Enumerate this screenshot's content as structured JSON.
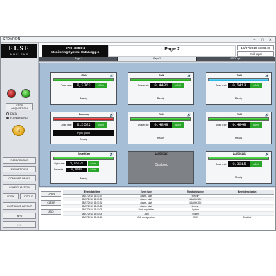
{
  "window": {
    "title": "STDMRON"
  },
  "logo": {
    "line1": "ELSE",
    "line2": "NUCLEAR"
  },
  "left_panel": {
    "stop_acquisition": "STOP\nACQUISITION",
    "radio_data": "DATA",
    "radio_forwarding": "FORWARDING",
    "nav_buttons": [
      "DATA GRAPHS",
      "EXPORT DATA",
      "COMMAND PANEL",
      "CONFIGURATION",
      "LOGIN",
      "LOGOUT",
      "CUSTOMIZE LAYOUT",
      "INFO",
      "EXIT"
    ]
  },
  "header": {
    "title_line1": "5700 sMRON",
    "title_line2": "Monitoring System Data Logger",
    "page": "Page 2",
    "datetime": "18/07/2019 13:03:40",
    "user": "Sviluppo",
    "tabs": [
      "Page 1",
      "Page 2",
      "IPC Logs"
    ]
  },
  "cards": [
    {
      "name": "GM1",
      "bar": "green",
      "label": "Dose rate",
      "value": "0,3763",
      "unit": "uSv/h",
      "status": "Ready",
      "icon": "speaker-icon"
    },
    {
      "name": "GM2",
      "bar": "green",
      "label": "Dose rate",
      "value": "0,4431",
      "unit": "uSv/h",
      "status": "Ready",
      "icon": "speaker-icon"
    },
    {
      "name": "GM3",
      "bar": "cyan",
      "label": "Dose rate",
      "value": "0,5413",
      "unit": "uSv/h",
      "status": "Ready",
      "icon": "speaker-icon"
    },
    {
      "name": "Mercury",
      "bar": "red",
      "label": "Dose rate",
      "value": "0,5592",
      "unit": "uSv/h",
      "message": "Pippo pluto",
      "status": "Ready",
      "icon": "speaker-icon"
    },
    {
      "name": "GM4",
      "bar": "green",
      "label": "Dose rate",
      "value": "0,4849",
      "unit": "uSv/h",
      "status": "Ready",
      "icon": "speaker-icon"
    },
    {
      "name": "GM5",
      "bar": "green",
      "label": "Dose rate",
      "value": "0,4849",
      "unit": "uSv/h",
      "status": "Ready",
      "icon": "speaker-icon"
    },
    {
      "name": "SmartCam",
      "bar": "green",
      "alpha_label": "Alpha rate",
      "alpha_value": "1,91e-1",
      "alpha_unit": "uSv/h",
      "beta_label": "Beta rate",
      "beta_value": "0,9999",
      "beta_unit": "uSv/h",
      "status": "Ready",
      "icon": "speaker-icon"
    },
    {
      "name": "NAUDICA01",
      "disabled": "Disabled"
    },
    {
      "name": "NAUDICA02",
      "bar": "green",
      "label": "Dose rate",
      "value": "0,3315",
      "unit": "uSv/h",
      "status": "Ready",
      "icon": "speaker-icon"
    }
  ],
  "events": {
    "buttons": [
      "OPEN",
      "CLEAR",
      "ADD"
    ],
    "columns": [
      "Event date/time",
      "Event type",
      "Monitor/channel",
      "Event description"
    ],
    "rows": [
      [
        "18/07/2019 13:03:37",
        "alarm - start",
        "Mercury",
        ""
      ],
      [
        "18/07/2019 13:03:33",
        "alarm - start",
        "NAUDICA02",
        ""
      ],
      [
        "18/07/2019 13:03:31",
        "alarm - start",
        "NAUDICA02",
        ""
      ],
      [
        "18/07/2019 13:03:28",
        "alarm - start",
        "Mercury",
        ""
      ],
      [
        "18/07/2019 13:03:08",
        "Start acquisition",
        "System",
        ""
      ],
      [
        "18/07/2019 13:03:08",
        "Login",
        "System",
        ""
      ],
      [
        "18/07/2019 13:01:15",
        "Edit configuration",
        "GM2",
        "Disabled"
      ]
    ]
  }
}
